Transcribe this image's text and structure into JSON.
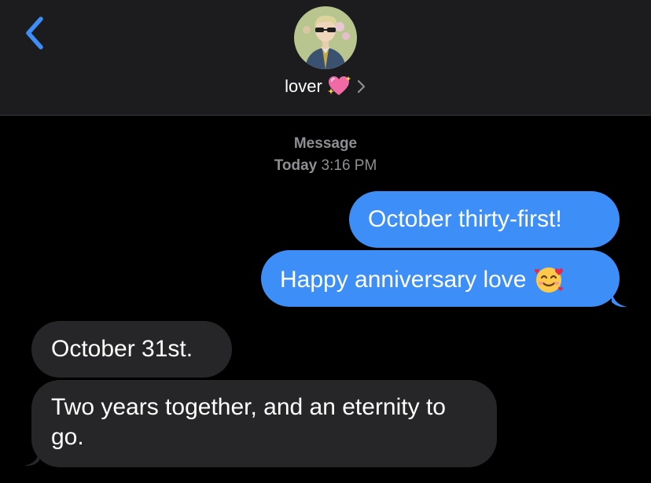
{
  "header": {
    "contact_name": "lover",
    "heart_emoji": "💖",
    "avatar_icon": "contact-avatar",
    "back_icon": "chevron-left-icon",
    "accent_color": "#3d8ef7"
  },
  "thread": {
    "service_label": "Message",
    "day_label": "Today",
    "time_label": "3:16 PM"
  },
  "messages": [
    {
      "direction": "sent",
      "text": "October thirty-first!"
    },
    {
      "direction": "sent",
      "text": "Happy anniversary love",
      "emoji": "🥰"
    },
    {
      "direction": "received",
      "text": "October 31st."
    },
    {
      "direction": "received",
      "text": "Two years together, and an eternity to go."
    }
  ],
  "colors": {
    "sent_bubble": "#3d8ef7",
    "received_bubble": "#262628",
    "header_bg": "#1c1c1e",
    "meta_text": "#8e8e93"
  }
}
